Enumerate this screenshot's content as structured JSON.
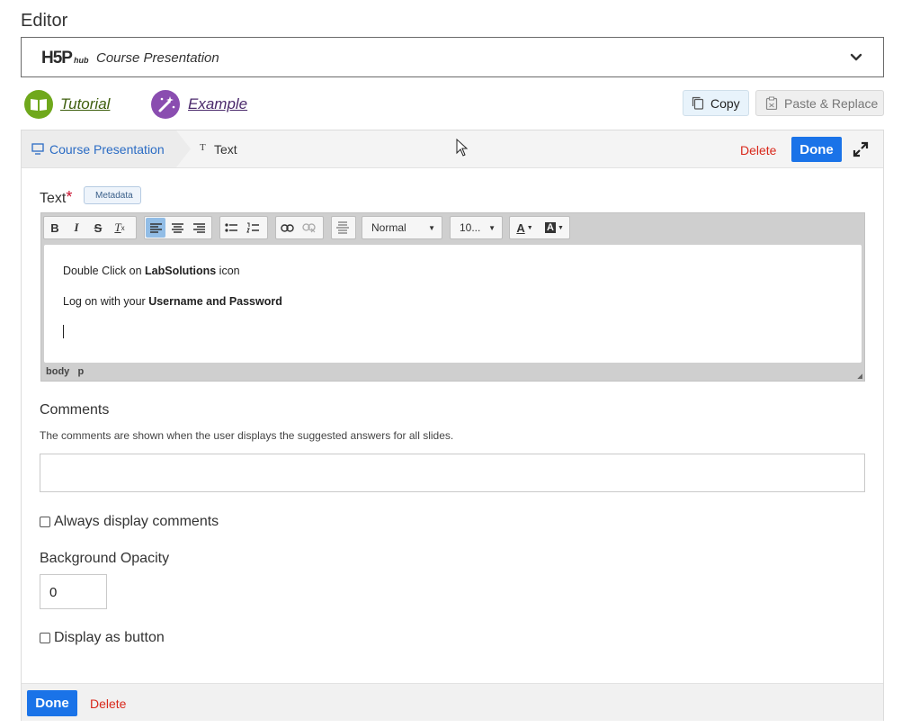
{
  "editor": {
    "label": "Editor"
  },
  "hub": {
    "logo_main": "H5P",
    "logo_sub": "hub",
    "content_type": "Course Presentation"
  },
  "links": {
    "tutorial": "Tutorial",
    "example": "Example"
  },
  "clipboard": {
    "copy": "Copy",
    "paste_replace": "Paste & Replace"
  },
  "breadcrumb": {
    "root": "Course Presentation",
    "current": "Text",
    "current_icon_glyph": "T"
  },
  "header_actions": {
    "delete": "Delete",
    "done": "Done"
  },
  "text_field": {
    "label": "Text",
    "required_mark": "*",
    "metadata": "Metadata",
    "toolbar": {
      "format": "Normal",
      "font_size": "10..."
    },
    "content": {
      "line1_pre": "Double Click on ",
      "line1_bold": "LabSolutions",
      "line1_post": " icon",
      "line2_pre": "Log on with your ",
      "line2_bold": "Username and Password"
    },
    "path": {
      "body": "body",
      "p": "p"
    }
  },
  "comments": {
    "label": "Comments",
    "description": "The comments are shown when the user displays the suggested answers for all slides.",
    "value": ""
  },
  "always_display": {
    "label": "Always display comments",
    "checked": false
  },
  "opacity": {
    "label": "Background Opacity",
    "value": "0"
  },
  "display_button": {
    "label": "Display as button",
    "checked": false
  },
  "footer_actions": {
    "done": "Done",
    "delete": "Delete"
  },
  "colors": {
    "primary_button": "#1a73e8",
    "delete_text": "#d9281b",
    "breadcrumb_link": "#2b6cc4",
    "tutorial_icon": "#6fa81c",
    "example_icon": "#8a4db0"
  }
}
